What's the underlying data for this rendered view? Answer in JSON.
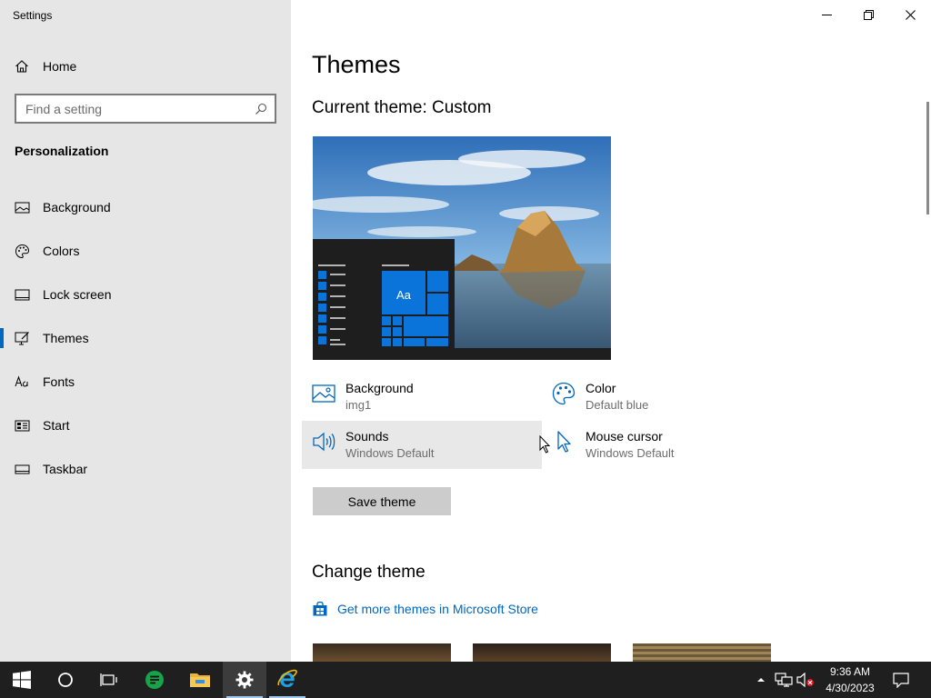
{
  "window": {
    "title": "Settings",
    "minimize_icon": "minimize-icon",
    "restore_icon": "restore-icon",
    "close_icon": "close-icon"
  },
  "sidebar": {
    "home_label": "Home",
    "search_placeholder": "Find a setting",
    "section": "Personalization",
    "items": [
      {
        "label": "Background",
        "icon": "picture-icon"
      },
      {
        "label": "Colors",
        "icon": "palette-icon"
      },
      {
        "label": "Lock screen",
        "icon": "lock-screen-icon"
      },
      {
        "label": "Themes",
        "icon": "themes-icon",
        "active": true
      },
      {
        "label": "Fonts",
        "icon": "fonts-icon"
      },
      {
        "label": "Start",
        "icon": "start-icon"
      },
      {
        "label": "Taskbar",
        "icon": "taskbar-icon"
      }
    ]
  },
  "main": {
    "title": "Themes",
    "current_theme": "Current theme: Custom",
    "preview_tile_label": "Aa",
    "properties": [
      {
        "title": "Background",
        "subtitle": "img1",
        "icon": "picture-icon"
      },
      {
        "title": "Color",
        "subtitle": "Default blue",
        "icon": "palette-icon"
      },
      {
        "title": "Sounds",
        "subtitle": "Windows Default",
        "icon": "speaker-icon"
      },
      {
        "title": "Mouse cursor",
        "subtitle": "Windows Default",
        "icon": "cursor-icon"
      }
    ],
    "save_button": "Save theme",
    "change_theme_heading": "Change theme",
    "store_link": "Get more themes in Microsoft Store"
  },
  "taskbar": {
    "apps": [
      "start-icon",
      "cortana-icon",
      "task-view-icon",
      "notes-app-icon",
      "file-explorer-icon",
      "settings-icon",
      "internet-explorer-icon"
    ],
    "clock_time": "9:36 AM",
    "clock_date": "4/30/2023"
  },
  "colors": {
    "accent": "#0067c0",
    "sidebar_bg": "#e6e6e6",
    "taskbar_bg": "#1f1f1f"
  }
}
